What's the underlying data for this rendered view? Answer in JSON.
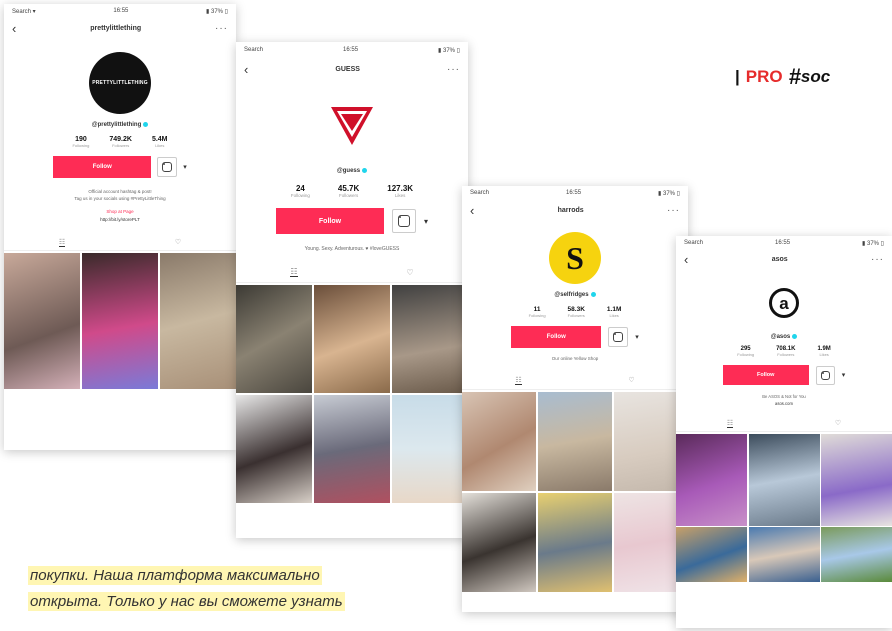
{
  "header_text": {
    "bar": "|",
    "pro": "PRO",
    "hash": "#",
    "rest": "soc"
  },
  "caption": {
    "line1": "покупки. Наша платформа максимально",
    "line2": "открыта. Только у нас вы сможете узнать"
  },
  "colors": {
    "follow": "#fe2c55",
    "pro": "#e62c2c",
    "highlight": "#fff6b3",
    "verify": "#20d5ec"
  },
  "phones": [
    {
      "id": "prettylittlething",
      "status_left": "Search ▾",
      "status_time": "16:55",
      "status_right": "▮ 37% ▯",
      "title": "prettylittlething",
      "handle": "@prettylittlething",
      "avatar_text": "PRETTYLITTLETHING",
      "stats": [
        {
          "num": "190",
          "lbl": "Following"
        },
        {
          "num": "749.2K",
          "lbl": "Followers"
        },
        {
          "num": "5.4M",
          "lbl": "Likes"
        }
      ],
      "follow_label": "Follow",
      "bio1": "Official account hashtag & post!",
      "bio2": "Tag us in your socials using #PrettyLittleThing",
      "link1": "Shop at Page",
      "link2": "http://bit.ly/storePLT"
    },
    {
      "id": "guess",
      "status_left": "Search",
      "status_time": "16:55",
      "status_right": "▮ 37% ▯",
      "title": "GUESS",
      "handle": "@guess",
      "avatar_text": "GUESS",
      "stats": [
        {
          "num": "24",
          "lbl": "Following"
        },
        {
          "num": "45.7K",
          "lbl": "Followers"
        },
        {
          "num": "127.3K",
          "lbl": "Likes"
        }
      ],
      "follow_label": "Follow",
      "bio1": "Young. Sexy. Adventurous. ♥ #loveGUESS"
    },
    {
      "id": "harrods",
      "status_left": "Search",
      "status_time": "16:55",
      "status_right": "▮ 37% ▯",
      "title": "harrods",
      "handle": "@selfridges",
      "avatar_text": "S",
      "stats": [
        {
          "num": "11",
          "lbl": "Following"
        },
        {
          "num": "58.3K",
          "lbl": "Followers"
        },
        {
          "num": "1.1M",
          "lbl": "Likes"
        }
      ],
      "follow_label": "Follow",
      "bio1": "Our online Yellow Shop"
    },
    {
      "id": "asos",
      "status_left": "Search",
      "status_time": "16:55",
      "status_right": "▮ 37% ▯",
      "title": "asos",
      "handle": "@asos",
      "avatar_text": "a",
      "stats": [
        {
          "num": "295",
          "lbl": "Following"
        },
        {
          "num": "708.1K",
          "lbl": "Followers"
        },
        {
          "num": "1.9M",
          "lbl": "Likes"
        }
      ],
      "follow_label": "Follow",
      "bio1": "Be ASOS & Not for You",
      "link1": "asos.com"
    }
  ]
}
